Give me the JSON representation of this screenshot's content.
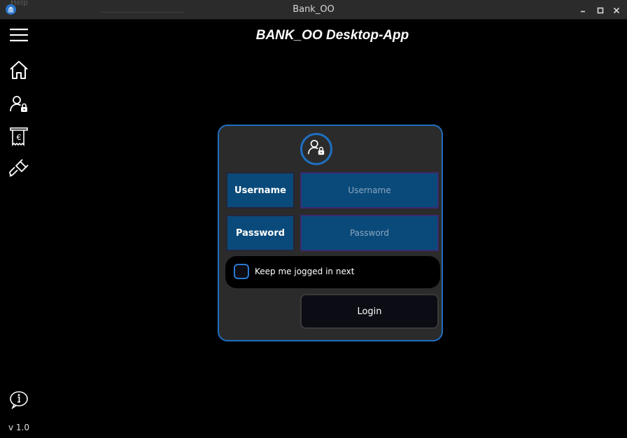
{
  "window": {
    "title": "Bank_OO",
    "ghost_menu_label": "Help"
  },
  "sidebar": {
    "items": [
      {
        "name": "menu",
        "icon": "hamburger-menu-icon"
      },
      {
        "name": "home",
        "icon": "home-icon"
      },
      {
        "name": "login",
        "icon": "user-lock-icon"
      },
      {
        "name": "transactions",
        "icon": "euro-receipt-icon"
      },
      {
        "name": "connection",
        "icon": "plug-icon"
      }
    ],
    "info_icon": "info-bubble-icon",
    "version": "v 1.0"
  },
  "header": {
    "title": "BANK_OO Desktop-App"
  },
  "login": {
    "avatar_icon": "user-lock-icon",
    "username_label": "Username",
    "username_placeholder": "Username",
    "username_value": "",
    "password_label": "Password",
    "password_placeholder": "Password",
    "password_value": "",
    "keep_label": "Keep me jogged in next",
    "keep_checked": false,
    "login_button": "Login"
  },
  "colors": {
    "accent": "#1f6fc0",
    "field_bg": "#0a4a7a",
    "card_bg": "#2b2b2b",
    "background": "#000000"
  }
}
